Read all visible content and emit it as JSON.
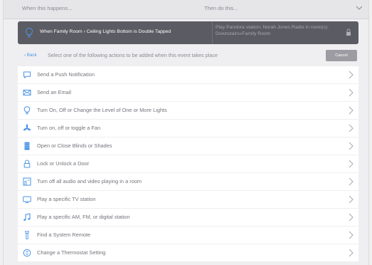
{
  "header": {
    "left_label": "When this happens...",
    "right_label": "Then do this..."
  },
  "trigger": {
    "text": "When Family Room › Ceiling Lights Bottom is Double Tapped",
    "action_line1": "Play Pandora station: Norah Jones Radio in room(s):",
    "action_line2": "Downstairs»Family Room"
  },
  "subheader": {
    "back_label": "‹ Back",
    "instruction": "Select one of the following actions to be added when this event takes place",
    "cancel_label": "Cancel"
  },
  "colors": {
    "accent_blue": "#4a94e6",
    "trigger_bar": "#5b5b63"
  },
  "actions": [
    {
      "label": "Send a Push Notification",
      "icon": "chat-bubble-icon"
    },
    {
      "label": "Send an Email",
      "icon": "envelope-icon"
    },
    {
      "label": "Turn On, Off or Change the Level of One or More Lights",
      "icon": "lightbulb-icon"
    },
    {
      "label": "Turn on, off or toggle a Fan",
      "icon": "fan-icon"
    },
    {
      "label": "Open or Close Blinds or Shades",
      "icon": "blinds-icon"
    },
    {
      "label": "Lock or Unlock a Door",
      "icon": "lock-icon"
    },
    {
      "label": "Turn off all audio and video playing in a room",
      "icon": "room-icon"
    },
    {
      "label": "Play a specific TV station",
      "icon": "tv-icon"
    },
    {
      "label": "Play a specific AM, FM, or digital station",
      "icon": "music-note-icon"
    },
    {
      "label": "Find a System Remote",
      "icon": "remote-icon"
    },
    {
      "label": "Change a Thermostat Setting",
      "icon": "thermostat-icon"
    }
  ]
}
